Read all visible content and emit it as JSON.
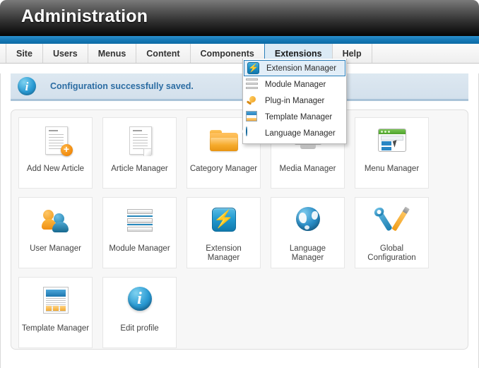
{
  "header": {
    "title": "Administration"
  },
  "menubar": {
    "items": [
      {
        "label": "Site",
        "active": false
      },
      {
        "label": "Users",
        "active": false
      },
      {
        "label": "Menus",
        "active": false
      },
      {
        "label": "Content",
        "active": false
      },
      {
        "label": "Components",
        "active": false
      },
      {
        "label": "Extensions",
        "active": true
      },
      {
        "label": "Help",
        "active": false
      }
    ]
  },
  "dropdown": {
    "open_for": "Extensions",
    "items": [
      {
        "label": "Extension Manager",
        "icon": "bolt-icon",
        "selected": true
      },
      {
        "label": "Module Manager",
        "icon": "stack-icon",
        "selected": false
      },
      {
        "label": "Plug-in Manager",
        "icon": "plug-icon",
        "selected": false
      },
      {
        "label": "Template Manager",
        "icon": "template-icon",
        "selected": false
      },
      {
        "label": "Language Manager",
        "icon": "globe-icon",
        "selected": false
      }
    ]
  },
  "message": {
    "icon": "info-icon",
    "text": "Configuration successfully saved.",
    "color": "#2c6da3"
  },
  "tiles": [
    {
      "label": "Add New Article",
      "icon": "article-add-icon"
    },
    {
      "label": "Article Manager",
      "icon": "article-icon"
    },
    {
      "label": "Category Manager",
      "icon": "folder-icon"
    },
    {
      "label": "Media Manager",
      "icon": "media-icon"
    },
    {
      "label": "Menu Manager",
      "icon": "menu-window-icon"
    },
    {
      "label": "User Manager",
      "icon": "users-icon"
    },
    {
      "label": "Module Manager",
      "icon": "module-stack-icon"
    },
    {
      "label": "Extension Manager",
      "icon": "bolt-icon"
    },
    {
      "label": "Language Manager",
      "icon": "globe-icon"
    },
    {
      "label": "Global Configuration",
      "icon": "tools-icon"
    },
    {
      "label": "Template Manager",
      "icon": "template-page-icon"
    },
    {
      "label": "Edit profile",
      "icon": "info-icon"
    }
  ],
  "glyphs": {
    "bolt": "⚡",
    "info": "i",
    "plus": "+"
  },
  "colors": {
    "accent_blue": "#1477b4",
    "header_dark": "#050505",
    "active_tab": "#dbeaf5",
    "orange": "#f0a020"
  }
}
